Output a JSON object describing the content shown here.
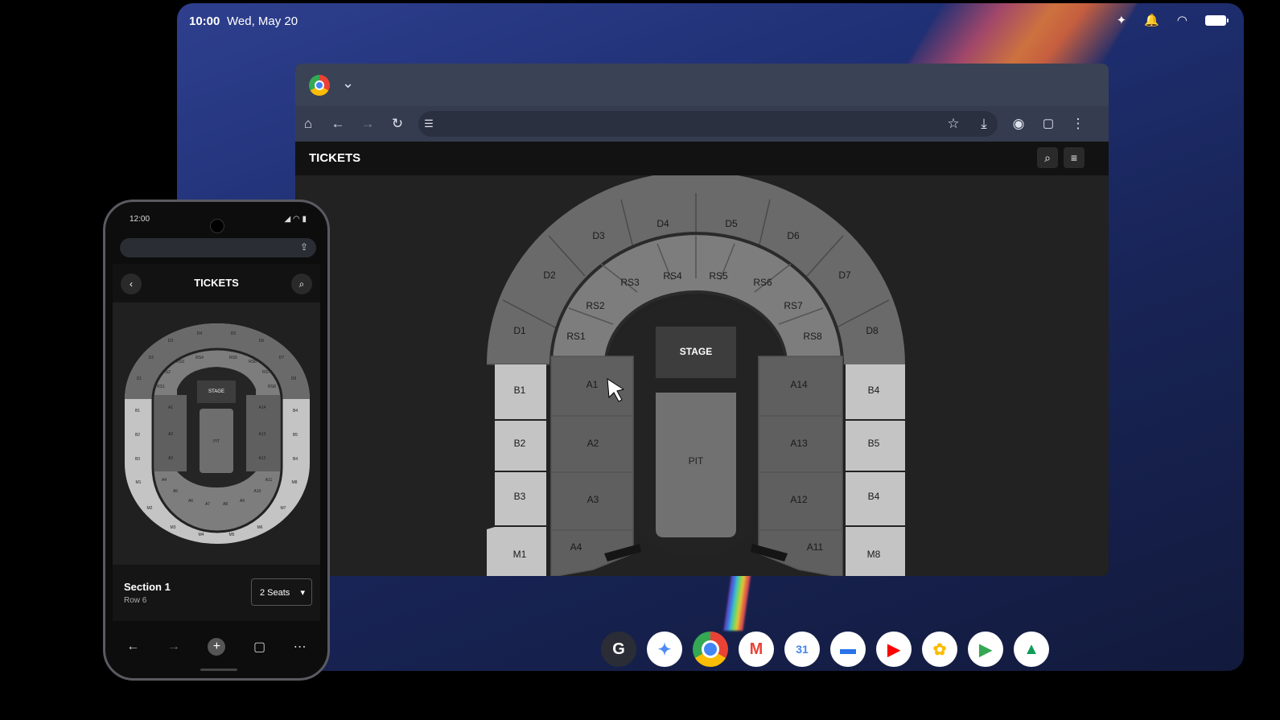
{
  "tablet": {
    "status": {
      "time": "10:00",
      "date": "Wed, May 20"
    },
    "browser": {
      "site_title": "TICKETS"
    },
    "seat_map": {
      "stage_label": "STAGE",
      "pit_label": "PIT",
      "outer_sections": [
        "D1",
        "D2",
        "D3",
        "D4",
        "D5",
        "D6",
        "D7",
        "D8"
      ],
      "ring_sections": [
        "RS1",
        "RS2",
        "RS3",
        "RS4",
        "RS5",
        "RS6",
        "RS7",
        "RS8"
      ],
      "floor_left": [
        "A1",
        "A2",
        "A3",
        "A4"
      ],
      "floor_right": [
        "A14",
        "A13",
        "A12",
        "A11"
      ],
      "side_left": [
        "B1",
        "B2",
        "B3",
        "M1"
      ],
      "side_right": [
        "B4",
        "B5",
        "B4",
        "M8"
      ]
    },
    "dock_apps": [
      "google",
      "gemini",
      "chrome",
      "gmail",
      "calendar",
      "files",
      "youtube",
      "photos",
      "play-store",
      "drive"
    ]
  },
  "phone": {
    "status_time": "12:00",
    "title": "TICKETS",
    "stage_label": "STAGE",
    "pit_label": "PIT",
    "mini_sections": {
      "outer": [
        "D1",
        "D2",
        "D3",
        "D4",
        "D5",
        "D6",
        "D7",
        "D8"
      ],
      "ring": [
        "RS1",
        "RS2",
        "RS3",
        "RS4",
        "RS5",
        "RS6",
        "RS7",
        "RS8"
      ],
      "left": [
        "A1",
        "A2",
        "A3"
      ],
      "right": [
        "A14",
        "A13",
        "A12"
      ],
      "side_left": [
        "B1",
        "B2",
        "B3"
      ],
      "side_right": [
        "B4",
        "B5",
        "B4"
      ],
      "bottom_inner": [
        "A4",
        "A5",
        "A6",
        "A7",
        "A8",
        "A9",
        "A10",
        "A11"
      ],
      "bottom_outer": [
        "M1",
        "M2",
        "M3",
        "M4",
        "M5",
        "M6",
        "M7",
        "M8"
      ]
    },
    "section": "Section 1",
    "row": "Row 6",
    "seats": "2 Seats"
  },
  "colors": {
    "section_dark": "#5f5f5f",
    "section_mid": "#7a7a7a",
    "section_light": "#c4c4c4",
    "stage": "#3a3a3a"
  }
}
